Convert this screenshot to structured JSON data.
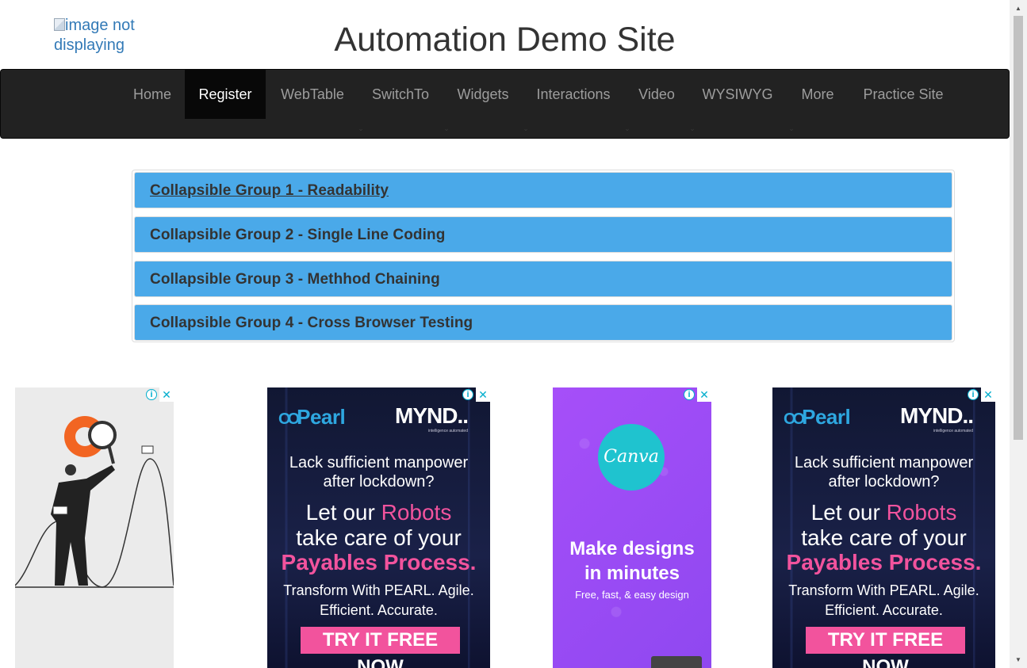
{
  "logo": {
    "alt_text": "image not displaying"
  },
  "site_title": "Automation Demo Site",
  "nav": {
    "items": [
      {
        "label": "Home",
        "active": false,
        "dropdown": false
      },
      {
        "label": "Register",
        "active": true,
        "dropdown": false
      },
      {
        "label": "WebTable",
        "active": false,
        "dropdown": false
      },
      {
        "label": "SwitchTo",
        "active": false,
        "dropdown": true
      },
      {
        "label": "Widgets",
        "active": false,
        "dropdown": true
      },
      {
        "label": "Interactions",
        "active": false,
        "dropdown": true
      },
      {
        "label": "Video",
        "active": false,
        "dropdown": true
      },
      {
        "label": "WYSIWYG",
        "active": false,
        "dropdown": true
      },
      {
        "label": "More",
        "active": false,
        "dropdown": true
      },
      {
        "label": "Practice Site",
        "active": false,
        "dropdown": false
      }
    ],
    "caret_icon": "chevron-down-icon"
  },
  "accordion": {
    "groups": [
      {
        "title": "Collapsible Group 1 - Readability"
      },
      {
        "title": "Collapsible Group 2 - Single Line Coding"
      },
      {
        "title": "Collapsible Group 3 - Methhod Chaining"
      },
      {
        "title": "Collapsible Group 4 - Cross Browser Testing"
      }
    ],
    "panel_color": "#4aa9e9"
  },
  "ads": {
    "pearl": {
      "brand": "Pearl",
      "partner": "MYND..",
      "partner_sub": "intelligence automated",
      "line1": "Lack sufficient manpower",
      "line2": "after lockdown?",
      "line3_a": "Let our ",
      "line3_b": "Robots",
      "line4": "take care of your",
      "line5": "Payables Process.",
      "line6": "Transform With PEARL. Agile.",
      "line7": "Efficient. Accurate.",
      "cta": "TRY IT FREE NOW"
    },
    "canva": {
      "logo": "Canva",
      "headline1": "Make designs",
      "headline2": "in minutes",
      "sub": "Free, fast, & easy design"
    },
    "controls": {
      "info": "i",
      "close": "✕"
    }
  }
}
